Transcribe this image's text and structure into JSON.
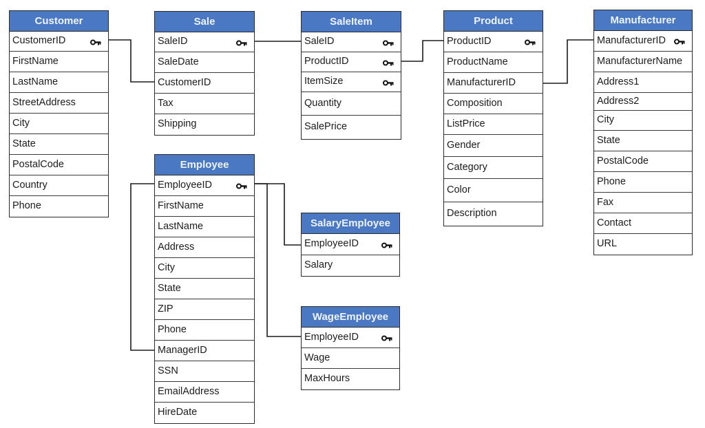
{
  "diagram": {
    "type": "entity-relationship",
    "entities": [
      {
        "id": "customer",
        "name": "Customer",
        "fields": [
          {
            "name": "CustomerID",
            "key": true
          },
          {
            "name": "FirstName",
            "key": false
          },
          {
            "name": "LastName",
            "key": false
          },
          {
            "name": "StreetAddress",
            "key": false
          },
          {
            "name": "City",
            "key": false
          },
          {
            "name": "State",
            "key": false
          },
          {
            "name": "PostalCode",
            "key": false
          },
          {
            "name": "Country",
            "key": false
          },
          {
            "name": "Phone",
            "key": false
          }
        ]
      },
      {
        "id": "sale",
        "name": "Sale",
        "fields": [
          {
            "name": "SaleID",
            "key": true
          },
          {
            "name": "SaleDate",
            "key": false
          },
          {
            "name": "CustomerID",
            "key": false
          },
          {
            "name": "Tax",
            "key": false
          },
          {
            "name": "Shipping",
            "key": false
          }
        ]
      },
      {
        "id": "saleitem",
        "name": "SaleItem",
        "fields": [
          {
            "name": "SaleID",
            "key": true
          },
          {
            "name": "ProductID",
            "key": true
          },
          {
            "name": "ItemSize",
            "key": true
          },
          {
            "name": "Quantity",
            "key": false
          },
          {
            "name": "SalePrice",
            "key": false
          }
        ]
      },
      {
        "id": "product",
        "name": "Product",
        "fields": [
          {
            "name": "ProductID",
            "key": true
          },
          {
            "name": "ProductName",
            "key": false
          },
          {
            "name": "ManufacturerID",
            "key": false
          },
          {
            "name": "Composition",
            "key": false
          },
          {
            "name": "ListPrice",
            "key": false
          },
          {
            "name": "Gender",
            "key": false
          },
          {
            "name": "Category",
            "key": false
          },
          {
            "name": "Color",
            "key": false
          },
          {
            "name": "Description",
            "key": false
          }
        ]
      },
      {
        "id": "manufacturer",
        "name": "Manufacturer",
        "fields": [
          {
            "name": "ManufacturerID",
            "key": true
          },
          {
            "name": "ManufacturerName",
            "key": false
          },
          {
            "name": "Address1",
            "key": false
          },
          {
            "name": "Address2",
            "key": false
          },
          {
            "name": "City",
            "key": false
          },
          {
            "name": "State",
            "key": false
          },
          {
            "name": "PostalCode",
            "key": false
          },
          {
            "name": "Phone",
            "key": false
          },
          {
            "name": "Fax",
            "key": false
          },
          {
            "name": "Contact",
            "key": false
          },
          {
            "name": "URL",
            "key": false
          }
        ]
      },
      {
        "id": "employee",
        "name": "Employee",
        "fields": [
          {
            "name": "EmployeeID",
            "key": true
          },
          {
            "name": "FirstName",
            "key": false
          },
          {
            "name": "LastName",
            "key": false
          },
          {
            "name": "Address",
            "key": false
          },
          {
            "name": "City",
            "key": false
          },
          {
            "name": "State",
            "key": false
          },
          {
            "name": "ZIP",
            "key": false
          },
          {
            "name": "Phone",
            "key": false
          },
          {
            "name": "ManagerID",
            "key": false
          },
          {
            "name": "SSN",
            "key": false
          },
          {
            "name": "EmailAddress",
            "key": false
          },
          {
            "name": "HireDate",
            "key": false
          }
        ]
      },
      {
        "id": "salaryemployee",
        "name": "SalaryEmployee",
        "fields": [
          {
            "name": "EmployeeID",
            "key": true
          },
          {
            "name": "Salary",
            "key": false
          }
        ]
      },
      {
        "id": "wageemployee",
        "name": "WageEmployee",
        "fields": [
          {
            "name": "EmployeeID",
            "key": true
          },
          {
            "name": "Wage",
            "key": false
          },
          {
            "name": "MaxHours",
            "key": false
          }
        ]
      }
    ],
    "relationships": [
      {
        "from": "customer.CustomerID",
        "to": "sale.CustomerID"
      },
      {
        "from": "sale.SaleID",
        "to": "saleitem.SaleID"
      },
      {
        "from": "saleitem.ProductID",
        "to": "product.ProductID"
      },
      {
        "from": "product.ManufacturerID",
        "to": "manufacturer.ManufacturerID"
      },
      {
        "from": "employee.EmployeeID",
        "to": "employee.ManagerID"
      },
      {
        "from": "employee.EmployeeID",
        "to": "salaryemployee.EmployeeID"
      },
      {
        "from": "employee.EmployeeID",
        "to": "wageemployee.EmployeeID"
      }
    ],
    "colors": {
      "header": "#4a78c2",
      "header_text": "#eef4ff",
      "border": "#2b2b2b",
      "line": "#1a1a1a"
    }
  }
}
